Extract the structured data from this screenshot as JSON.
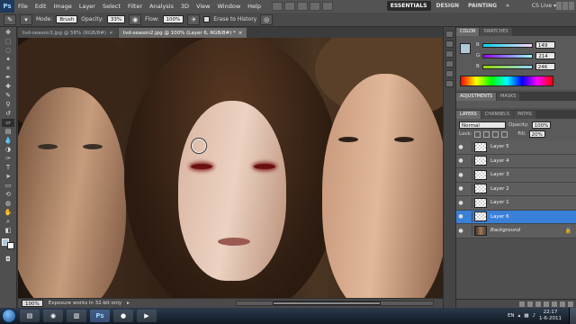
{
  "menu": {
    "logo": "Ps",
    "items": [
      "File",
      "Edit",
      "Image",
      "Layer",
      "Select",
      "Filter",
      "Analysis",
      "3D",
      "View",
      "Window",
      "Help"
    ],
    "workspaces": [
      "ESSENTIALS",
      "DESIGN",
      "PAINTING",
      "»"
    ],
    "cslive": "CS Live ▾"
  },
  "options": {
    "mode_label": "Mode:",
    "mode_value": "Brush",
    "opacity_label": "Opacity:",
    "opacity_value": "33%",
    "flow_label": "Flow:",
    "flow_value": "100%",
    "erase_history": "Erase to History"
  },
  "tabs": [
    {
      "label": "tvd-season3.jpg @ 58% (RGB/8#)",
      "active": false
    },
    {
      "label": "tvd-season2.jpg @ 100% (Layer 6, RGB/8#) *",
      "active": true
    }
  ],
  "status": {
    "zoom": "100%",
    "message": "Exposure works in 32-bit only"
  },
  "color_panel": {
    "tabs": [
      "COLOR",
      "SWATCHES"
    ],
    "channels": [
      {
        "name": "R",
        "value": "149"
      },
      {
        "name": "G",
        "value": "214"
      },
      {
        "name": "B",
        "value": "246"
      }
    ],
    "foreground": "#b0c8d8"
  },
  "adjustments": {
    "tabs": [
      "ADJUSTMENTS",
      "MASKS"
    ]
  },
  "layers": {
    "tabs": [
      "LAYERS",
      "CHANNELS",
      "PATHS"
    ],
    "blend_mode": "Normal",
    "opacity_label": "Opacity:",
    "opacity_value": "100%",
    "lock_label": "Lock:",
    "fill_label": "Fill:",
    "fill_value": "20%",
    "items": [
      {
        "name": "Layer 5",
        "active": false
      },
      {
        "name": "Layer 4",
        "active": false
      },
      {
        "name": "Layer 3",
        "active": false
      },
      {
        "name": "Layer 2",
        "active": false
      },
      {
        "name": "Layer 1",
        "active": false
      },
      {
        "name": "Layer 6",
        "active": true
      },
      {
        "name": "Background",
        "active": false
      }
    ]
  },
  "taskbar": {
    "lang": "EN",
    "time": "22:17",
    "date": "1-6-2011"
  },
  "colors": {
    "selection": "#3a7fd8",
    "panel": "#4f4f4f"
  }
}
